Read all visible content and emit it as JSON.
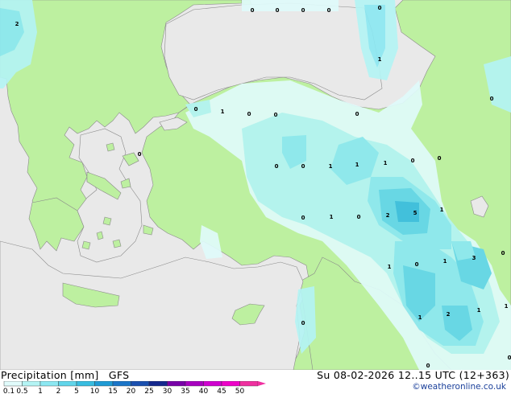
{
  "map": {
    "legend": {
      "title": "Precipitation [mm]",
      "model": "GFS",
      "ticks": [
        "0.1",
        "0.5",
        "1",
        "2",
        "5",
        "10",
        "15",
        "20",
        "25",
        "30",
        "35",
        "40",
        "45",
        "50"
      ],
      "colors": [
        "#e0fbfb",
        "#b4f4f4",
        "#8ce8f2",
        "#61d5ea",
        "#38bde0",
        "#1f9bd5",
        "#1a75c8",
        "#1a50b0",
        "#14288e",
        "#7800a8",
        "#a800c0",
        "#d000d0",
        "#ee00c8",
        "#f030a0"
      ]
    },
    "valid_time": "Su 08-02-2026 12..15 UTC (12+363)",
    "credit": "©weatheronline.co.uk",
    "colors": {
      "land": "#bdf0a0",
      "sea": "#e9e9e9"
    },
    "station_values": [
      {
        "id": "s1",
        "text": "2"
      },
      {
        "id": "s2",
        "text": "0"
      },
      {
        "id": "s3",
        "text": "0"
      },
      {
        "id": "s4",
        "text": "0"
      },
      {
        "id": "s5",
        "text": "0"
      },
      {
        "id": "s6",
        "text": "0"
      },
      {
        "id": "s7",
        "text": "1"
      },
      {
        "id": "s8",
        "text": "0"
      },
      {
        "id": "s9",
        "text": "1"
      },
      {
        "id": "s10",
        "text": "0"
      },
      {
        "id": "s11",
        "text": "0"
      },
      {
        "id": "s12",
        "text": "0"
      },
      {
        "id": "s13",
        "text": "0"
      },
      {
        "id": "s14",
        "text": "0"
      },
      {
        "id": "s15",
        "text": "0"
      },
      {
        "id": "s16",
        "text": "1"
      },
      {
        "id": "s17",
        "text": "1"
      },
      {
        "id": "s18",
        "text": "1"
      },
      {
        "id": "s19",
        "text": "0"
      },
      {
        "id": "s20",
        "text": "0"
      },
      {
        "id": "s21",
        "text": "0"
      },
      {
        "id": "s22",
        "text": "1"
      },
      {
        "id": "s23",
        "text": "0"
      },
      {
        "id": "s24",
        "text": "2"
      },
      {
        "id": "s25",
        "text": "5"
      },
      {
        "id": "s26",
        "text": "1"
      },
      {
        "id": "s27",
        "text": "1"
      },
      {
        "id": "s28",
        "text": "0"
      },
      {
        "id": "s29",
        "text": "1"
      },
      {
        "id": "s30",
        "text": "3"
      },
      {
        "id": "s31",
        "text": "0"
      },
      {
        "id": "s32",
        "text": "1"
      },
      {
        "id": "s33",
        "text": "2"
      },
      {
        "id": "s34",
        "text": "1"
      },
      {
        "id": "s35",
        "text": "1"
      },
      {
        "id": "s36",
        "text": "0"
      },
      {
        "id": "s37",
        "text": "0"
      },
      {
        "id": "s38",
        "text": "0"
      },
      {
        "id": "s39",
        "text": "0"
      }
    ]
  }
}
